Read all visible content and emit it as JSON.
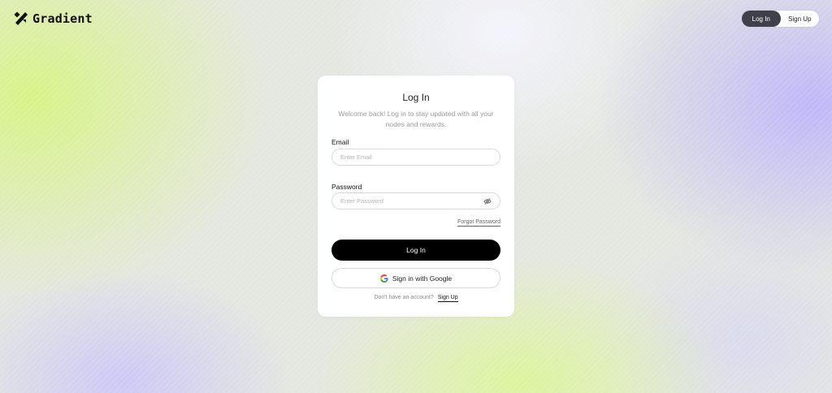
{
  "brand": {
    "name": "Gradient",
    "logo_icon": "gradient-logo-icon"
  },
  "header": {
    "login_tab": "Log In",
    "signup_tab": "Sign Up",
    "active_tab": "login"
  },
  "login_form": {
    "title": "Log In",
    "subtitle": "Welcome back! Log in to stay updated with all your nodes and rewards.",
    "email_label": "Email",
    "email_placeholder": "Enter Email",
    "email_value": "",
    "password_label": "Password",
    "password_placeholder": "Enter Password",
    "password_value": "",
    "password_icon": "eye-off-icon",
    "forgot_password": "Forgot Password",
    "login_button": "Log In",
    "google_button": "Sign in with Google",
    "google_icon": "google-icon",
    "signup_prompt": "Don't have an account?",
    "signup_link": "Sign Up"
  },
  "colors": {
    "primary_button": "#000000",
    "active_tab": "#3f4049",
    "accent_green": "#d6f578",
    "accent_purple": "#beb4fa"
  }
}
